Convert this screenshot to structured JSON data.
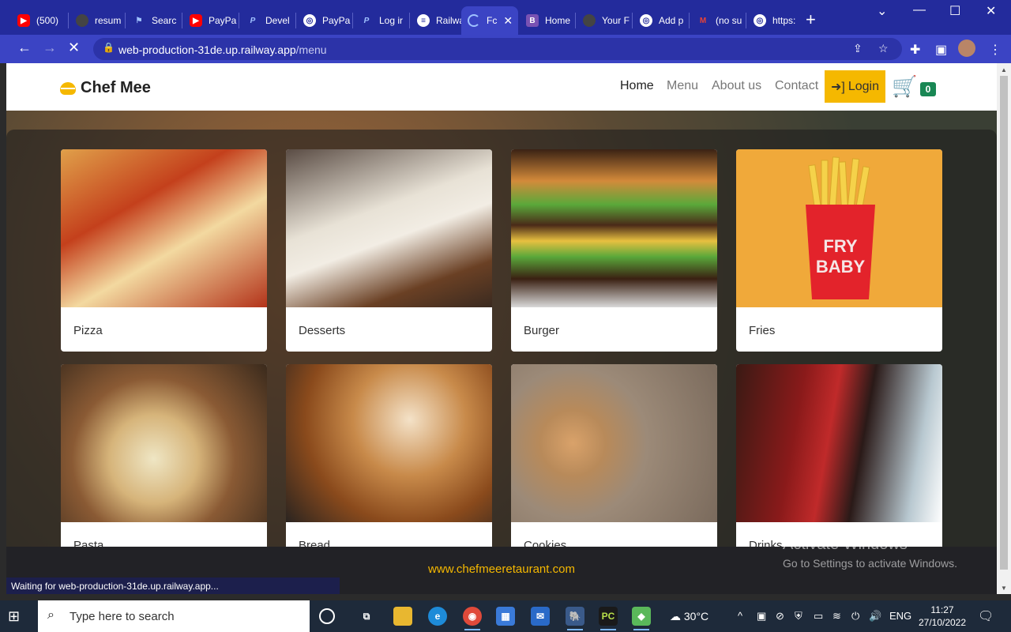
{
  "browser": {
    "tabs": [
      {
        "label": "(500)",
        "icon": "youtube-icon",
        "color": "#ff0000"
      },
      {
        "label": "resum",
        "icon": "github-icon",
        "color": "#222222"
      },
      {
        "label": "Searc",
        "icon": "flag-icon",
        "color": "#5b8def"
      },
      {
        "label": "PayPa",
        "icon": "youtube-icon",
        "color": "#ff0000"
      },
      {
        "label": "Devel",
        "icon": "paypal-icon",
        "color": "#0d5bb5"
      },
      {
        "label": "PayPa",
        "icon": "globe-icon",
        "color": "#ffffff"
      },
      {
        "label": "Log ir",
        "icon": "paypal-icon",
        "color": "#0d5bb5"
      },
      {
        "label": "Railwa",
        "icon": "railway-icon",
        "color": "#ffffff"
      },
      {
        "label": "Fc",
        "icon": "loading-icon",
        "color": "#8ab4f8",
        "active": true
      },
      {
        "label": "Home",
        "icon": "bootstrap-icon",
        "color": "#7952b3"
      },
      {
        "label": "Your F",
        "icon": "github-icon",
        "color": "#222222"
      },
      {
        "label": "Add p",
        "icon": "globe-icon",
        "color": "#ffffff"
      },
      {
        "label": "(no su",
        "icon": "gmail-icon",
        "color": "#ea4335"
      },
      {
        "label": "https:",
        "icon": "globe-icon",
        "color": "#ffffff"
      }
    ],
    "url_host": "web-production-31de.up.railway.app",
    "url_path": "/menu",
    "status_text": "Waiting for web-production-31de.up.railway.app..."
  },
  "site": {
    "brand": "Chef Mee",
    "nav": {
      "home": "Home",
      "menu": "Menu",
      "about": "About us",
      "contact": "Contact"
    },
    "login": "Login",
    "cart_count": "0",
    "footer": "www.chefmeeretaurant.com",
    "accent": "#f5b800",
    "badge_color": "#198754"
  },
  "menu": {
    "categories": [
      "Pizza",
      "Desserts",
      "Burger",
      "Fries",
      "Pasta",
      "Bread",
      "Cookies",
      "Drinks"
    ]
  },
  "watermark": {
    "title": "Activate Windows",
    "subtitle": "Go to Settings to activate Windows."
  },
  "taskbar": {
    "search_placeholder": "Type here to search",
    "weather": "30°C",
    "language": "ENG",
    "time": "11:27",
    "date": "27/10/2022"
  }
}
